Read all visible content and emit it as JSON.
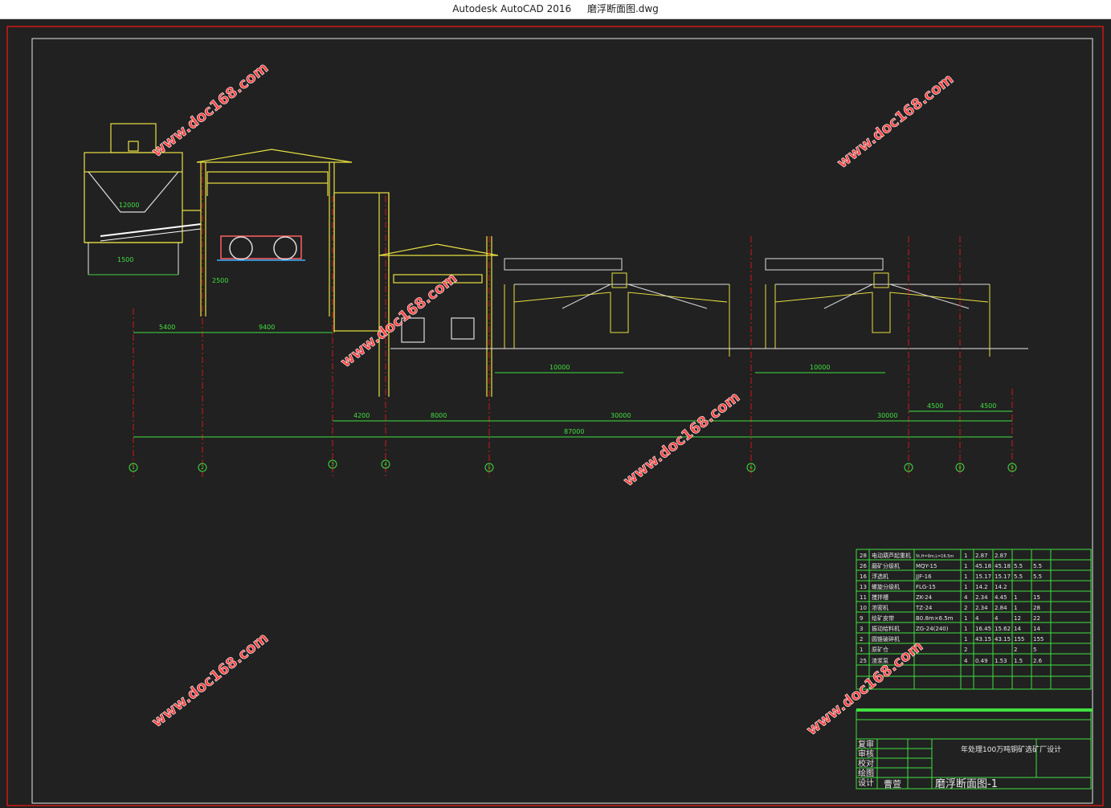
{
  "window": {
    "app_title": "Autodesk AutoCAD 2016",
    "file_name": "磨浮断面图.dwg"
  },
  "watermark": "www.doc168.com",
  "dimensions": {
    "d1": "5400",
    "d2": "9400",
    "d3": "4200",
    "d4": "8000",
    "d5": "30000",
    "d6": "30000",
    "d7": "10000",
    "d8": "10000",
    "d9": "4500",
    "d10": "4500",
    "total": "87000",
    "bin_width": "12000",
    "bin_inner": "1500",
    "mill_gap": "2500"
  },
  "axis_labels": [
    "1",
    "2",
    "3",
    "4",
    "5",
    "6",
    "7",
    "8",
    "9"
  ],
  "equipment_table": {
    "rows": [
      [
        "28",
        "电动葫芦起重机",
        "5t,H=9m,L=16.5m",
        "1",
        "2.87",
        "2.87",
        "",
        "",
        "",
        ""
      ],
      [
        "26",
        "磨矿分级机",
        "MQY-15",
        "1",
        "45.18",
        "45.18",
        "5.5",
        "5.5",
        "",
        ""
      ],
      [
        "16",
        "浮选机",
        "JJF-16",
        "1",
        "15.17",
        "15.17",
        "5.5",
        "5.5",
        "",
        ""
      ],
      [
        "13",
        "螺旋分级机",
        "FLG-15",
        "1",
        "14.2",
        "14.2",
        "",
        "",
        "",
        ""
      ],
      [
        "11",
        "搅拌槽",
        "ZK-24",
        "4",
        "2.34",
        "4.45",
        "1",
        "15",
        "",
        ""
      ],
      [
        "10",
        "浓密机",
        "TZ-24",
        "2",
        "2.34",
        "2.84",
        "1",
        "28",
        "",
        ""
      ],
      [
        "9",
        "给矿皮带",
        "B0.8m×6.5m",
        "1",
        "4",
        "4",
        "12",
        "22",
        "",
        ""
      ],
      [
        "3",
        "振动给料机",
        "ZG-24(240)",
        "1",
        "16.45",
        "15.62",
        "14",
        "14",
        "",
        ""
      ],
      [
        "2",
        "圆锥破碎机",
        "",
        "1",
        "43.15",
        "43.15",
        "155",
        "155",
        "",
        ""
      ],
      [
        "1",
        "原矿仓",
        "",
        "2",
        "",
        "",
        "2",
        "5",
        "",
        ""
      ],
      [
        "25",
        "渣浆泵",
        "",
        "4",
        "0.49",
        "1.53",
        "1.5",
        "2.6",
        "",
        ""
      ]
    ]
  },
  "title_block": {
    "project": "年处理100万吨铜矿选矿厂设计",
    "drawing_title": "磨浮断面图-1",
    "designer_name": "曹萱",
    "roles": [
      "复审",
      "审核",
      "校对",
      "绘图",
      "设计"
    ]
  }
}
